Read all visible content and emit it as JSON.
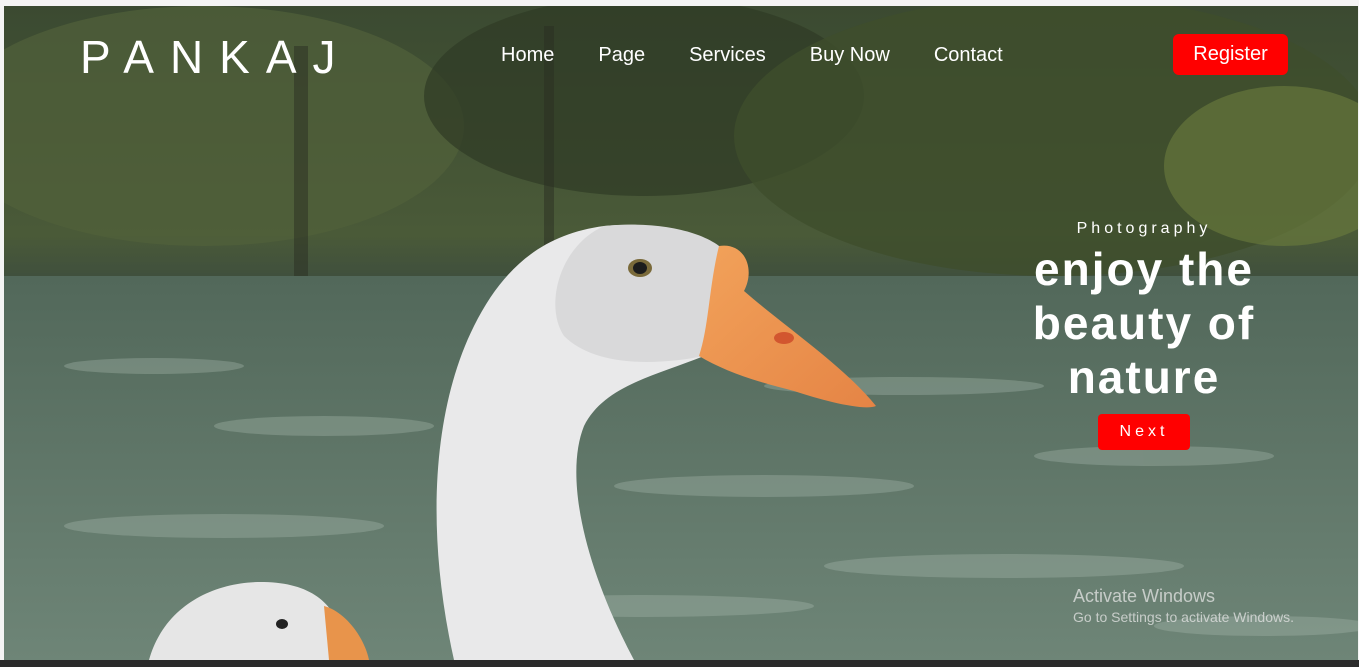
{
  "brand": {
    "logo": "PANKAJ"
  },
  "nav": {
    "items": [
      {
        "label": "Home"
      },
      {
        "label": "Page"
      },
      {
        "label": "Services"
      },
      {
        "label": "Buy Now"
      },
      {
        "label": "Contact"
      }
    ],
    "register_label": "Register"
  },
  "hero": {
    "kicker": "Photography",
    "headline_lines": [
      "enjoy the",
      "beauty of",
      "nature"
    ],
    "next_label": "Next",
    "image_subject": "white goose on a lake"
  },
  "watermark": {
    "line1": "Activate Windows",
    "line2": "Go to Settings to activate Windows."
  },
  "colors": {
    "accent": "#ff0000",
    "text": "#ffffff"
  }
}
